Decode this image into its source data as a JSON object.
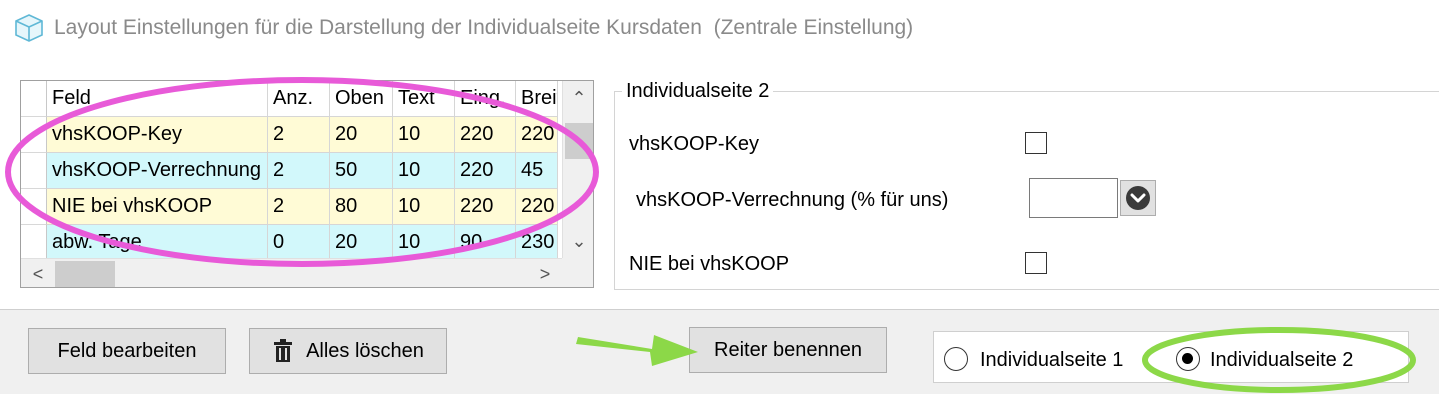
{
  "title": {
    "text": "Layout Einstellungen für die Darstellung der Individualseite Kursdaten  (Zentrale Einstellung)",
    "icon": "cube-icon"
  },
  "grid": {
    "columns": [
      "Feld",
      "Anz.",
      "Oben",
      "Text",
      "Eing.",
      "Breit"
    ],
    "rows": [
      {
        "feld": "vhsKOOP-Key",
        "anz": "2",
        "oben": "20",
        "text": "10",
        "eing": "220",
        "breit": "220"
      },
      {
        "feld": "vhsKOOP-Verrechnung",
        "anz": "2",
        "oben": "50",
        "text": "10",
        "eing": "220",
        "breit": "45"
      },
      {
        "feld": "NIE bei vhsKOOP",
        "anz": "2",
        "oben": "80",
        "text": "10",
        "eing": "220",
        "breit": "220"
      },
      {
        "feld": "abw. Tage",
        "anz": "0",
        "oben": "20",
        "text": "10",
        "eing": "90",
        "breit": "230"
      }
    ],
    "scroll_up": "⌃",
    "scroll_down": "⌄",
    "scroll_left": "<",
    "scroll_right": ">"
  },
  "group": {
    "legend": "Individualseite 2",
    "field1_label": "vhsKOOP-Key",
    "field2_label": "vhsKOOP-Verrechnung (% für uns)",
    "field2_value": "",
    "field3_label": "NIE bei vhsKOOP"
  },
  "buttons": {
    "edit_field": "Feld bearbeiten",
    "delete_all": "Alles löschen",
    "rename_tab": "Reiter benennen"
  },
  "radio": {
    "option1": "Individualseite 1",
    "option2": "Individualseite 2",
    "selected": "Individualseite 2"
  },
  "annotations": {
    "grid_highlight_color": "#e85ad8",
    "radio_highlight_color": "#8cd848",
    "arrow_color": "#8cd848"
  }
}
